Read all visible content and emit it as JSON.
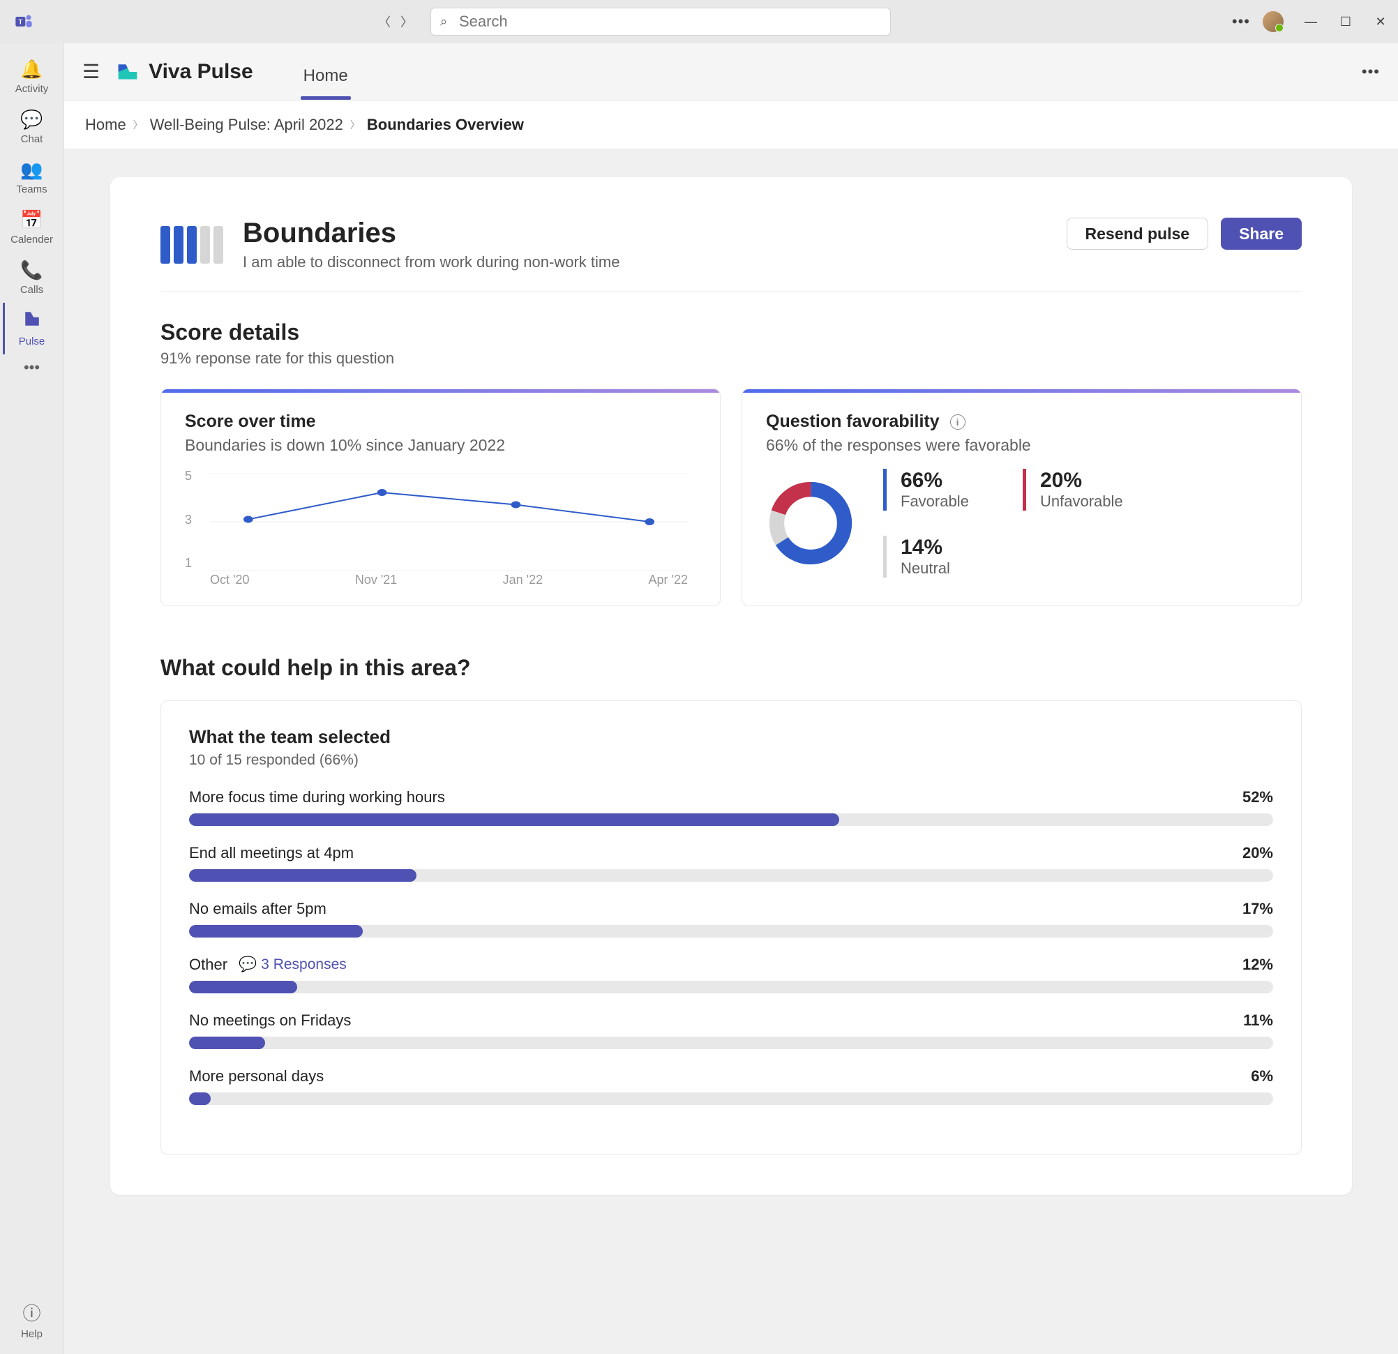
{
  "search_placeholder": "Search",
  "rail": {
    "items": [
      {
        "label": "Activity",
        "icon": "bell"
      },
      {
        "label": "Chat",
        "icon": "chat"
      },
      {
        "label": "Teams",
        "icon": "teams"
      },
      {
        "label": "Calender",
        "icon": "calendar"
      },
      {
        "label": "Calls",
        "icon": "phone"
      },
      {
        "label": "Pulse",
        "icon": "pulse",
        "active": true
      }
    ],
    "help_label": "Help"
  },
  "app": {
    "title": "Viva Pulse",
    "tabs": [
      {
        "label": "Home",
        "active": true
      }
    ]
  },
  "breadcrumb": {
    "home": "Home",
    "parent": "Well-Being Pulse: April 2022",
    "current": "Boundaries Overview"
  },
  "header": {
    "title": "Boundaries",
    "subtitle": "I am able to disconnect from work during non-work time",
    "resend_label": "Resend pulse",
    "share_label": "Share"
  },
  "score": {
    "title": "Score details",
    "subtitle": "91% reponse rate for this question",
    "over_time": {
      "title": "Score over time",
      "subtitle": "Boundaries is down 10% since January 2022"
    },
    "favorability": {
      "title": "Question favorability",
      "subtitle": "66% of the responses were favorable",
      "favorable": {
        "value": "66%",
        "label": "Favorable",
        "color": "#2f5cc9"
      },
      "unfavorable": {
        "value": "20%",
        "label": "Unfavorable",
        "color": "#c4314b"
      },
      "neutral": {
        "value": "14%",
        "label": "Neutral",
        "color": "#d6d6d6"
      }
    }
  },
  "help": {
    "title": "What could help in this area?",
    "card_title": "What the team selected",
    "card_sub": "10 of 15 responded (66%)",
    "responses_link": "3 Responses",
    "rows": [
      {
        "label": "More focus time during working hours",
        "pct": "52%",
        "width": 60
      },
      {
        "label": "End all meetings at 4pm",
        "pct": "20%",
        "width": 21
      },
      {
        "label": "No emails after 5pm",
        "pct": "17%",
        "width": 16
      },
      {
        "label": "Other",
        "pct": "12%",
        "width": 10,
        "has_responses": true
      },
      {
        "label": "No meetings on Fridays",
        "pct": "11%",
        "width": 7
      },
      {
        "label": "More personal days",
        "pct": "6%",
        "width": 2
      }
    ]
  },
  "chart_data": {
    "type": "line",
    "title": "Score over time",
    "xlabel": "",
    "ylabel": "",
    "ylim": [
      1,
      5
    ],
    "y_ticks": [
      1,
      3,
      5
    ],
    "categories": [
      "Oct '20",
      "Nov '21",
      "Jan '22",
      "Apr '22"
    ],
    "values": [
      3.1,
      4.2,
      3.7,
      3.0
    ]
  }
}
